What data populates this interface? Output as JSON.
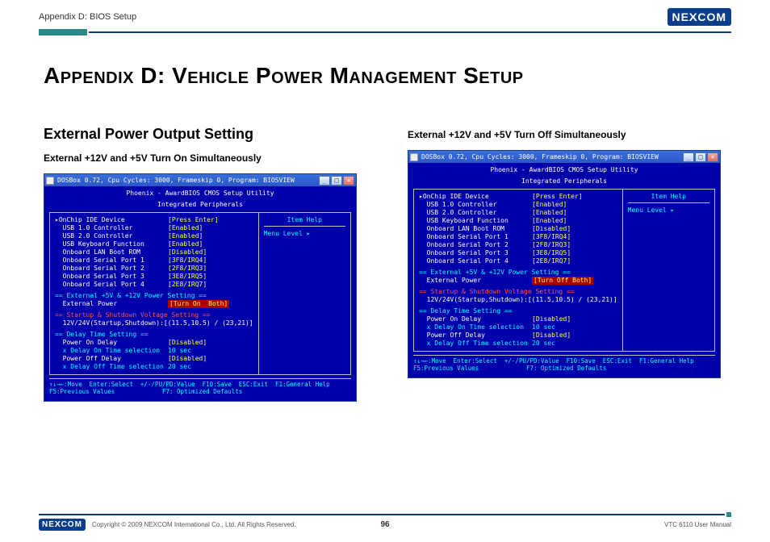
{
  "header": {
    "breadcrumb": "Appendix D: BIOS Setup",
    "logo_text": "NEXCOM"
  },
  "title": "Appendix D: Vehicle Power Management Setup",
  "col_left": {
    "heading": "External Power Output Setting",
    "subheading": "External +12V and +5V Turn On Simultaneously",
    "win_title": "DOSBox 0.72, Cpu Cycles:   3000, Frameskip  0, Program: BIOSVIEW",
    "bios_hdr1": "Phoenix - AwardBIOS CMOS Setup Utility",
    "bios_hdr2": "Integrated Peripherals",
    "rows": [
      {
        "label": "OnChip IDE Device",
        "value": "[Press Enter]",
        "sel": true
      },
      {
        "label": "USB 1.0 Controller",
        "value": "[Enabled]"
      },
      {
        "label": "USB 2.0 Controller",
        "value": "[Enabled]"
      },
      {
        "label": "USB Keyboard Function",
        "value": "[Enabled]"
      },
      {
        "label": "Onboard LAN Boot ROM",
        "value": "[Disabled]"
      },
      {
        "label": "Onboard Serial Port 1",
        "value": "[3F8/IRQ4]"
      },
      {
        "label": "Onboard Serial Port 2",
        "value": "[2F8/IRQ3]"
      },
      {
        "label": "Onboard Serial Port 3",
        "value": "[3E8/IRQ5]"
      },
      {
        "label": "Onboard Serial Port 4",
        "value": "[2E8/IRQ7]"
      }
    ],
    "sec1": "== External +5V & +12V Power Setting ==",
    "ext_power_label": "External Power",
    "ext_power_value": "[Turn On  Both]",
    "sec2": "== Startup & Shutdown Voltage Setting ==",
    "voltline": "12V/24V(Startup,Shutdown):[(11.5,10.5) / (23,21)]",
    "sec3": "== Delay Time Setting ==",
    "delay_rows": [
      {
        "label": "Power On Delay",
        "value": "[Disabled]",
        "color": "white"
      },
      {
        "label": "x Delay On Time selection",
        "value": "10 sec",
        "color": "cyan"
      },
      {
        "label": "Power Off Delay",
        "value": "[Disabled]",
        "color": "white"
      },
      {
        "label": "x Delay Off Time selection",
        "value": "20 sec",
        "color": "cyan"
      }
    ],
    "help_title": "Item Help",
    "help_body": "Menu Level   ▸",
    "keys1": "↑↓→←:Move  Enter:Select  +/-/PU/PD:Value  F10:Save  ESC:Exit  F1:General Help",
    "keys2": "F5:Previous Values             F7: Optimized Defaults"
  },
  "col_right": {
    "subheading": "External +12V and +5V Turn Off Simultaneously",
    "win_title": "DOSBox 0.72, Cpu Cycles:    3000, Frameskip  0, Program: BIOSVIEW",
    "bios_hdr1": "Phoenix - AwardBIOS CMOS Setup Utility",
    "bios_hdr2": "Integrated Peripherals",
    "rows": [
      {
        "label": "OnChip IDE Device",
        "value": "[Press Enter]",
        "sel": true
      },
      {
        "label": "USB 1.0 Controller",
        "value": "[Enabled]"
      },
      {
        "label": "USB 2.0 Controller",
        "value": "[Enabled]"
      },
      {
        "label": "USB Keyboard Function",
        "value": "[Enabled]"
      },
      {
        "label": "Onboard LAN Boot ROM",
        "value": "[Disabled]"
      },
      {
        "label": "Onboard Serial Port 1",
        "value": "[3F8/IRQ4]"
      },
      {
        "label": "Onboard Serial Port 2",
        "value": "[2F8/IRQ3]"
      },
      {
        "label": "Onboard Serial Port 3",
        "value": "[3E8/IRQ5]"
      },
      {
        "label": "Onboard Serial Port 4",
        "value": "[2E8/IRQ7]"
      }
    ],
    "sec1": "== External +5V & +12V Power Setting ==",
    "ext_power_label": "External Power",
    "ext_power_value": "[Turn Off Both]",
    "sec2": "== Startup & Shutdown Voltage Setting ==",
    "voltline": "12V/24V(Startup,Shutdown):[(11.5,10.5) / (23,21)]",
    "sec3": "== Delay Time Setting ==",
    "delay_rows": [
      {
        "label": "Power On Delay",
        "value": "[Disabled]",
        "color": "white"
      },
      {
        "label": "x Delay On Time selection",
        "value": "10 sec",
        "color": "cyan"
      },
      {
        "label": "Power Off Delay",
        "value": "[Disabled]",
        "color": "white"
      },
      {
        "label": "x Delay Off Time selection",
        "value": "20 sec",
        "color": "cyan"
      }
    ],
    "help_title": "Item Help",
    "help_body": "Menu Level   ▸",
    "keys1": "↑↓→←:Move  Enter:Select  +/-/PU/PD:Value  F10:Save  ESC:Exit  F1:General Help",
    "keys2": "F5:Previous Values             F7: Optimized Defaults"
  },
  "footer": {
    "logo_text": "NEXCOM",
    "copyright": "Copyright © 2009 NEXCOM International Co., Ltd. All Rights Reserved.",
    "page": "96",
    "doc": "VTC 6110 User Manual"
  }
}
